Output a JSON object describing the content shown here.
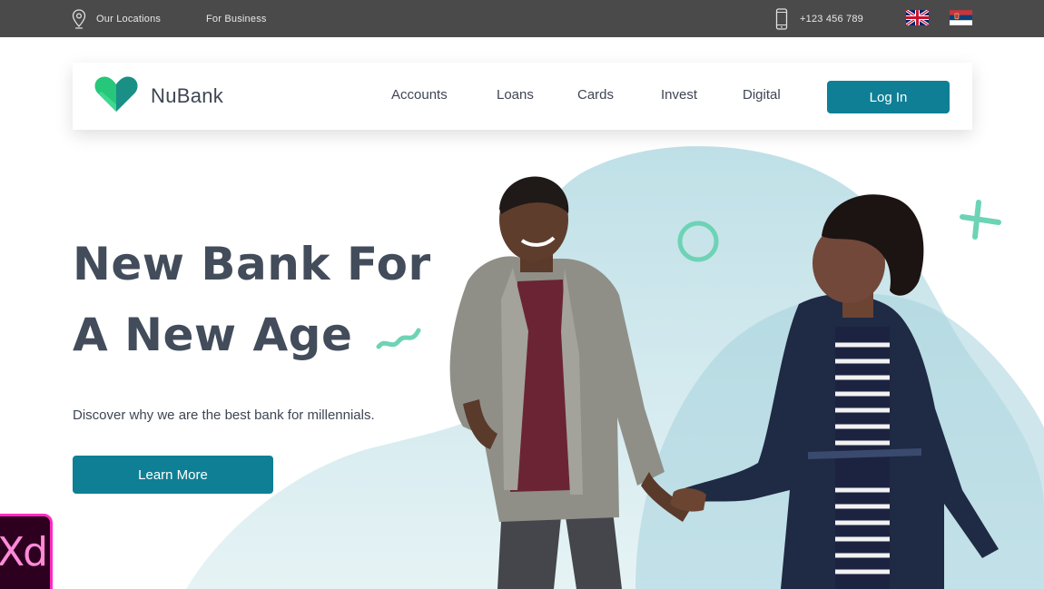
{
  "topbar": {
    "locations_label": "Our Locations",
    "business_label": "For Business",
    "phone": "+123 456 789",
    "languages": [
      {
        "name": "English",
        "icon": "uk-flag-icon"
      },
      {
        "name": "Serbian",
        "icon": "serbia-flag-icon"
      }
    ]
  },
  "nav": {
    "brand": "NuBank",
    "links": [
      "Accounts",
      "Loans",
      "Cards",
      "Invest",
      "Digital"
    ],
    "login_label": "Log In"
  },
  "hero": {
    "title_line1": "New Bank For",
    "title_line2": "A New Age",
    "subtitle": "Discover why we are the best bank for millennials.",
    "cta_label": "Learn More"
  },
  "badge": {
    "text": "Xd"
  },
  "colors": {
    "primary": "#0f7f95",
    "accent_mint": "#6dd3b5",
    "topbar": "#4a4a4a",
    "heading": "#424c5b",
    "blob": "#cfe7ec"
  }
}
